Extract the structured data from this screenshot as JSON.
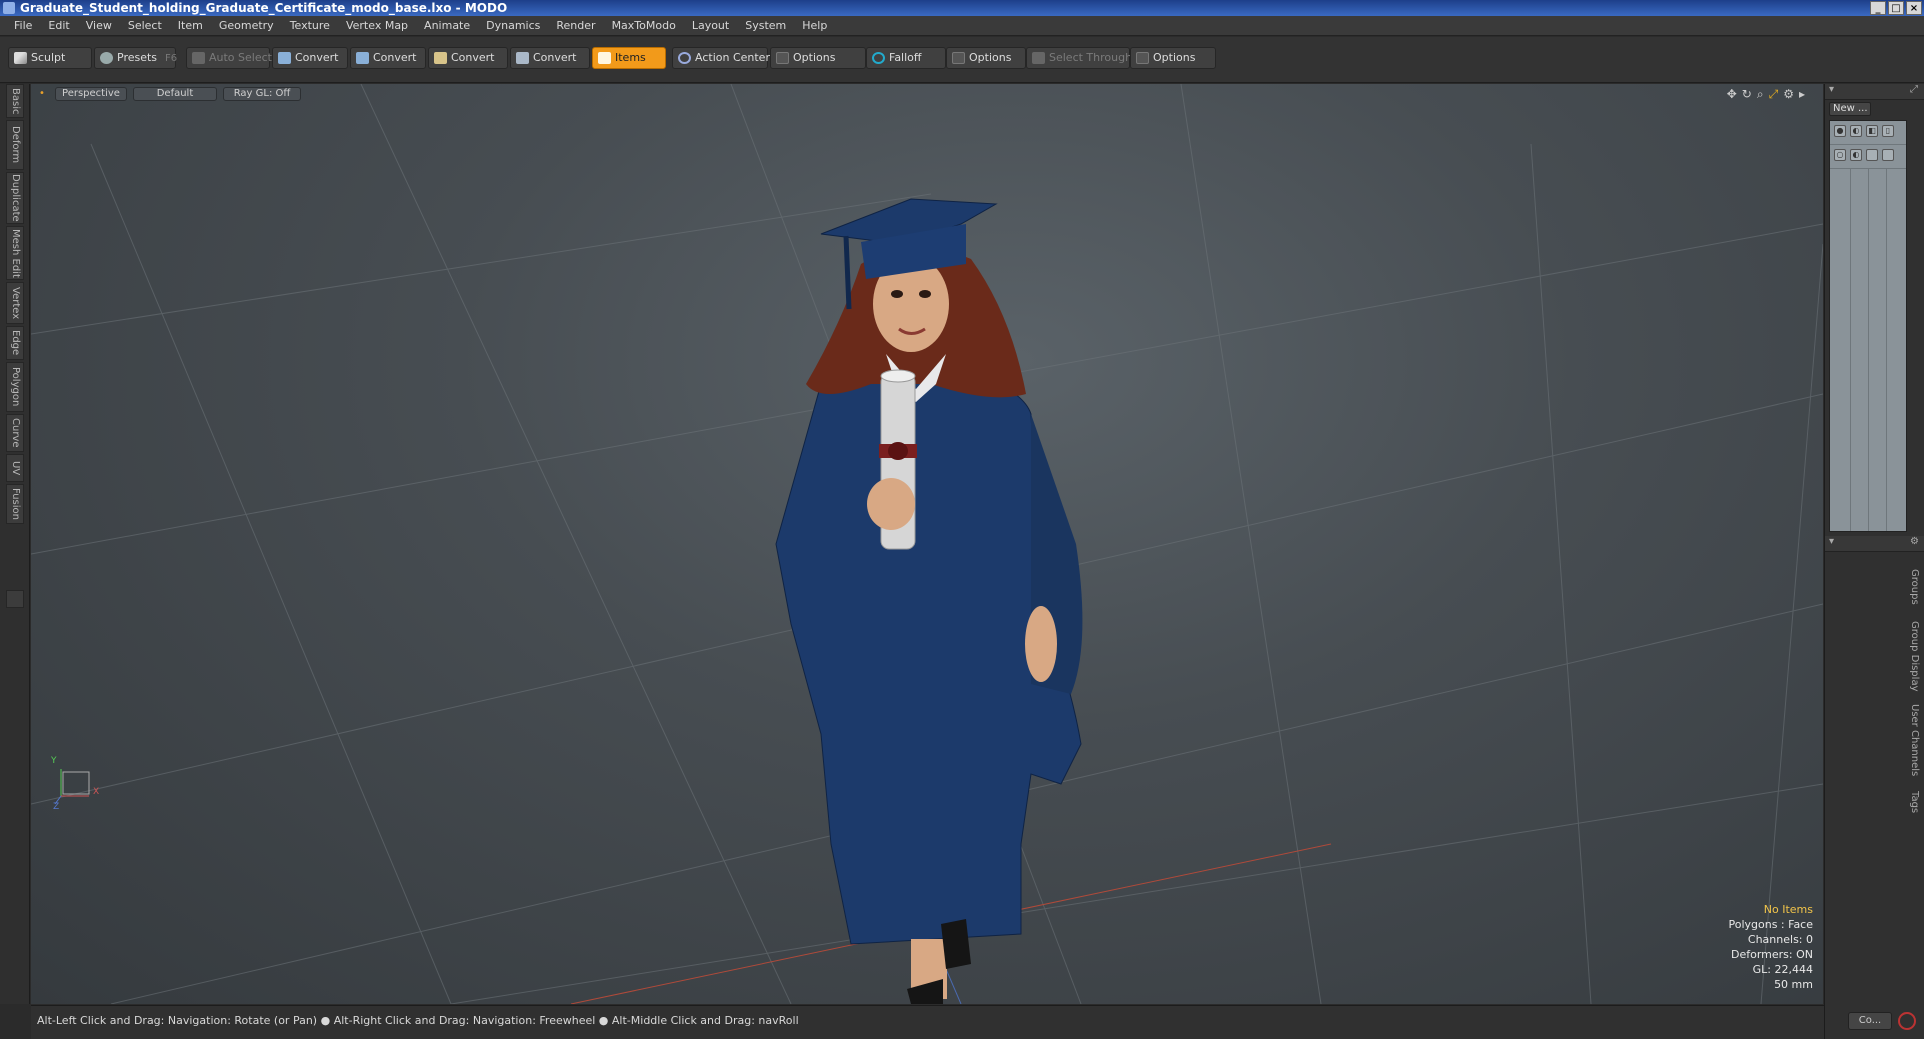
{
  "window": {
    "title": "Graduate_Student_holding_Graduate_Certificate_modo_base.lxo - MODO",
    "controls": [
      "_",
      "□",
      "×"
    ]
  },
  "menu": [
    "File",
    "Edit",
    "View",
    "Select",
    "Item",
    "Geometry",
    "Texture",
    "Vertex Map",
    "Animate",
    "Dynamics",
    "Render",
    "MaxToModo",
    "Layout",
    "System",
    "Help"
  ],
  "toolbar": {
    "sculpt": "Sculpt",
    "presets": "Presets",
    "presets_key": "F6",
    "auto_select": "Auto Select",
    "convert_1": "Convert",
    "convert_2": "Convert",
    "convert_3": "Convert",
    "convert_4": "Convert",
    "items": "Items",
    "action_center": "Action Center",
    "options_1": "Options",
    "falloff": "Falloff",
    "options_2": "Options",
    "select_through": "Select Through",
    "options_3": "Options"
  },
  "left_tabs": [
    "Basic",
    "Deform",
    "Duplicate",
    "Mesh Edit",
    "Vertex",
    "Edge",
    "Polygon",
    "Curve",
    "UV",
    "Fusion"
  ],
  "viewport": {
    "view_mode": "Perspective",
    "shading": "Default",
    "raygl": "Ray GL: Off",
    "info": {
      "items": "No Items",
      "polygons": "Polygons : Face",
      "channels": "Channels: 0",
      "deformers": "Deformers: ON",
      "gl": "GL: 22,444",
      "scale": "50 mm"
    },
    "axis": {
      "y": "Y",
      "x": "X",
      "z": "Z"
    }
  },
  "right_panel": {
    "new_button": "New ...",
    "side_tabs": [
      "Groups",
      "Group Display",
      "User Channels",
      "Tags"
    ]
  },
  "status": {
    "hint_1": "Alt-Left Click and Drag: Navigation: Rotate (or Pan)",
    "hint_2": "Alt-Right Click and Drag: Navigation: Freewheel",
    "hint_3": "Alt-Middle Click and Drag: navRoll",
    "command_button": "Co..."
  },
  "colors": {
    "accent": "#f29a1a",
    "gown": "#1c3a6b",
    "hair": "#6a2a1a"
  }
}
